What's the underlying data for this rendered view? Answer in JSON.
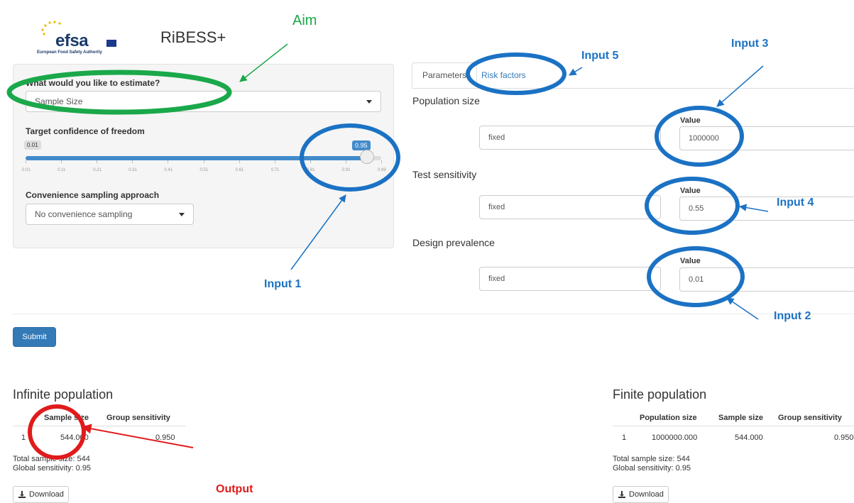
{
  "header": {
    "logo_text": "efsa",
    "logo_subtitle": "European Food Safety Authority",
    "app_title": "RiBESS+"
  },
  "left_panel": {
    "estimate_label": "What would you like to estimate?",
    "estimate_value": "Sample Size",
    "confidence_label": "Target confidence of freedom",
    "slider": {
      "min_label": "0.01",
      "value_label": "0.95",
      "value": 0.95,
      "min": 0.01,
      "max": 0.99,
      "ticks": [
        "0.01",
        "0.11",
        "0.21",
        "0.31",
        "0.41",
        "0.51",
        "0.61",
        "0.71",
        "0.81",
        "0.91",
        "0.99"
      ]
    },
    "convenience_label": "Convenience sampling approach",
    "convenience_value": "No convenience sampling"
  },
  "tabs": [
    {
      "label": "Parameters",
      "active": true
    },
    {
      "label": "Risk factors",
      "active": false
    }
  ],
  "parameters": [
    {
      "title": "Population size",
      "mode": "fixed",
      "value_label": "Value",
      "value": "1000000"
    },
    {
      "title": "Test sensitivity",
      "mode": "fixed",
      "value_label": "Value",
      "value": "0.55"
    },
    {
      "title": "Design prevalence",
      "mode": "fixed",
      "value_label": "Value",
      "value": "0.01"
    }
  ],
  "submit_label": "Submit",
  "infinite": {
    "title": "Infinite population",
    "columns": [
      "Sample size",
      "Group sensitivity"
    ],
    "row": {
      "index": "1",
      "sample_size": "544.000",
      "group_sensitivity": "0.950"
    },
    "total": "Total sample size: 544",
    "global": "Global sensitivity: 0.95",
    "download": "Download"
  },
  "finite": {
    "title": "Finite population",
    "columns": [
      "Population size",
      "Sample size",
      "Group sensitivity"
    ],
    "row": {
      "index": "1",
      "population_size": "1000000.000",
      "sample_size": "544.000",
      "group_sensitivity": "0.950"
    },
    "total": "Total sample size: 544",
    "global": "Global sensitivity: 0.95",
    "download": "Download"
  },
  "annotations": {
    "aim": "Aim",
    "input1": "Input 1",
    "input2": "Input 2",
    "input3": "Input 3",
    "input4": "Input 4",
    "input5": "Input 5",
    "output": "Output"
  },
  "colors": {
    "aim": "#1aa84a",
    "input": "#1b72c4",
    "output": "#e01b1b",
    "primary": "#337ab7"
  }
}
